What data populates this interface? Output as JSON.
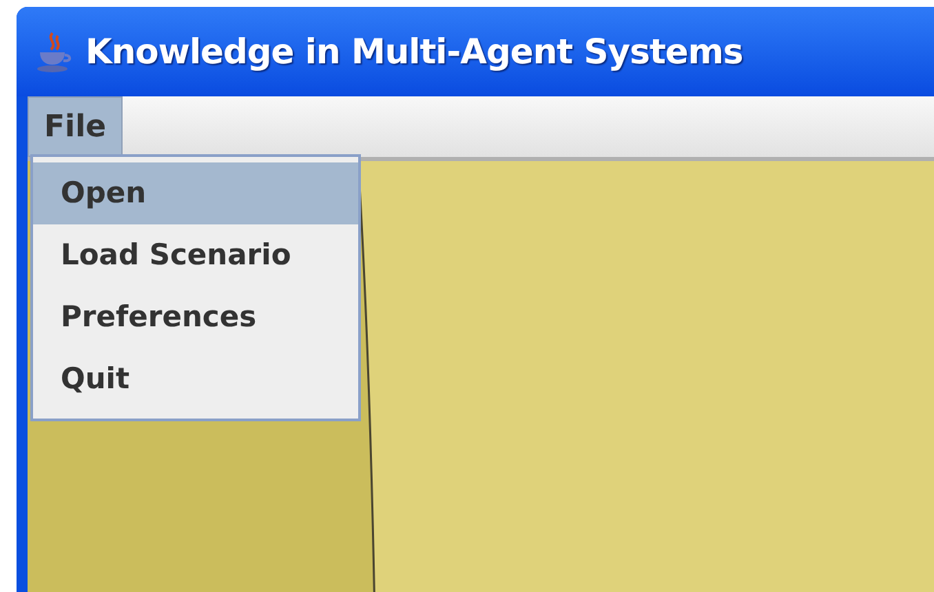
{
  "window": {
    "title": "Knowledge in Multi-Agent Systems"
  },
  "menu_bar": [
    {
      "label": "File",
      "selected": true
    }
  ],
  "menu": {
    "items": [
      {
        "label": "Open",
        "selected": true
      },
      {
        "label": "Load Scenario",
        "selected": false
      },
      {
        "label": "Preferences",
        "selected": false
      },
      {
        "label": "Quit",
        "selected": false
      }
    ]
  }
}
